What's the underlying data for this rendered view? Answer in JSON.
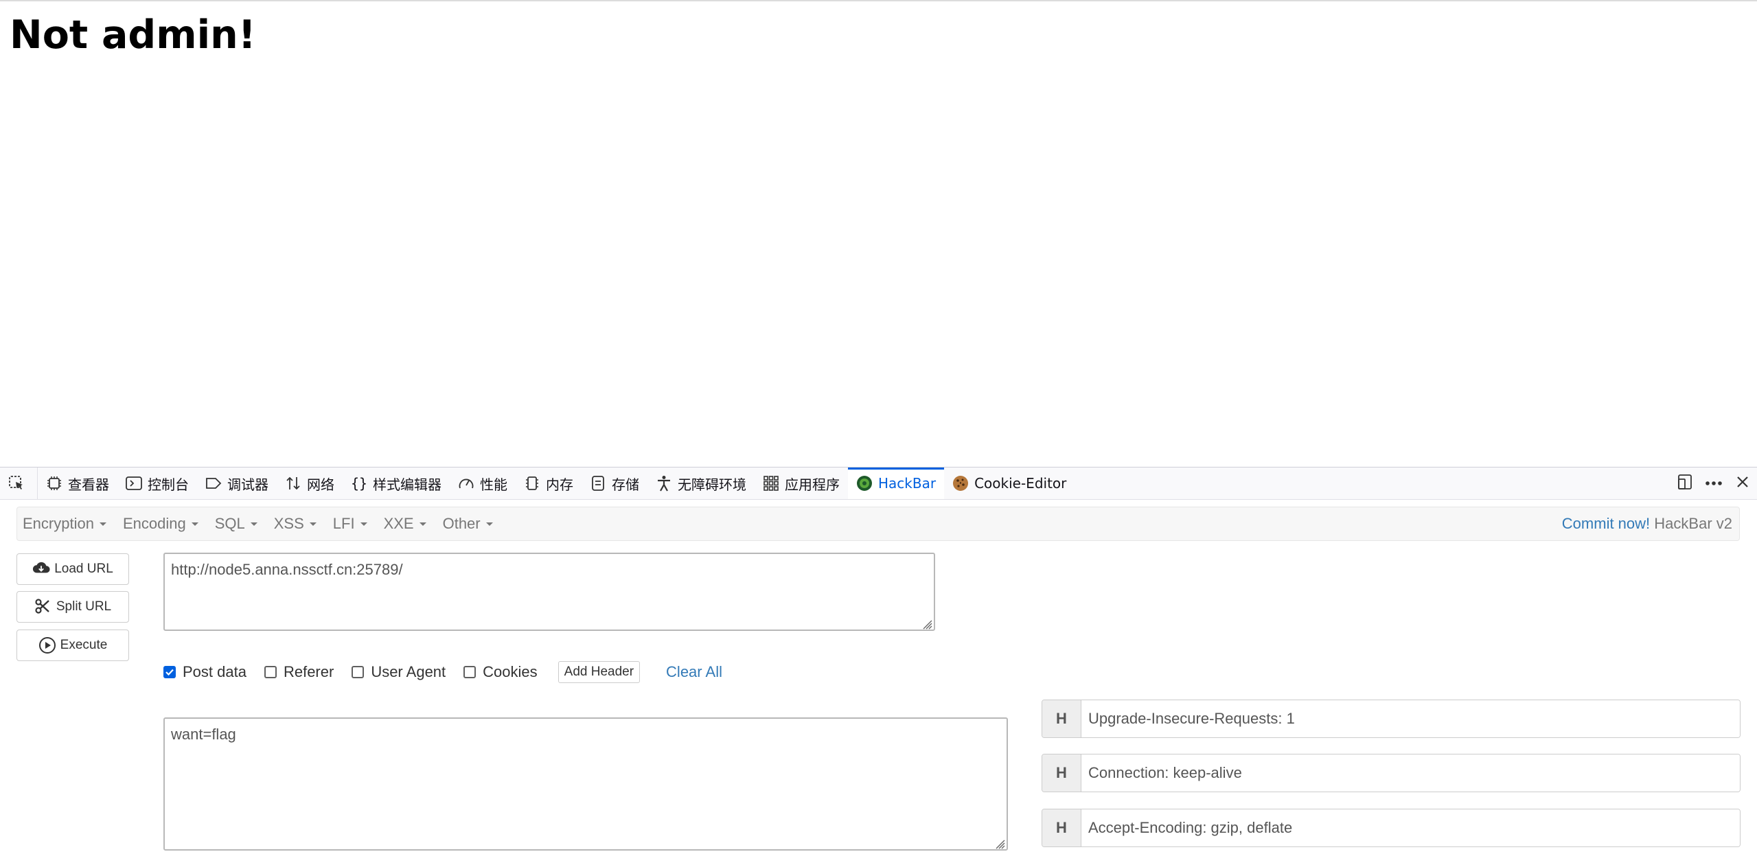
{
  "page": {
    "heading": "Not admin!"
  },
  "devtools": {
    "tabs": [
      {
        "label": "查看器",
        "icon": "inspector-icon"
      },
      {
        "label": "控制台",
        "icon": "console-icon"
      },
      {
        "label": "调试器",
        "icon": "debugger-icon"
      },
      {
        "label": "网络",
        "icon": "network-icon"
      },
      {
        "label": "样式编辑器",
        "icon": "style-editor-icon"
      },
      {
        "label": "性能",
        "icon": "performance-icon"
      },
      {
        "label": "内存",
        "icon": "memory-icon"
      },
      {
        "label": "存储",
        "icon": "storage-icon"
      },
      {
        "label": "无障碍环境",
        "icon": "accessibility-icon"
      },
      {
        "label": "应用程序",
        "icon": "application-icon"
      },
      {
        "label": "HackBar",
        "icon": "hackbar-icon",
        "active": true
      },
      {
        "label": "Cookie-Editor",
        "icon": "cookie-icon"
      }
    ]
  },
  "hackbar": {
    "menu": [
      "Encryption",
      "Encoding",
      "SQL",
      "XSS",
      "LFI",
      "XXE",
      "Other"
    ],
    "commit": "Commit now!",
    "version": "HackBar v2",
    "buttons": {
      "load": "Load URL",
      "split": "Split URL",
      "execute": "Execute"
    },
    "url": "http://node5.anna.nssctf.cn:25789/",
    "options": {
      "post": "Post data",
      "referer": "Referer",
      "user_agent": "User Agent",
      "cookies": "Cookies",
      "add_header": "Add Header",
      "clear_all": "Clear All"
    },
    "post_data": "want=flag",
    "headers": [
      {
        "key": "H",
        "value": "Upgrade-Insecure-Requests: 1"
      },
      {
        "key": "H",
        "value": "Connection: keep-alive"
      },
      {
        "key": "H",
        "value": "Accept-Encoding: gzip, deflate"
      }
    ]
  },
  "colors": {
    "accent": "#0060df",
    "link": "#337ab7"
  }
}
